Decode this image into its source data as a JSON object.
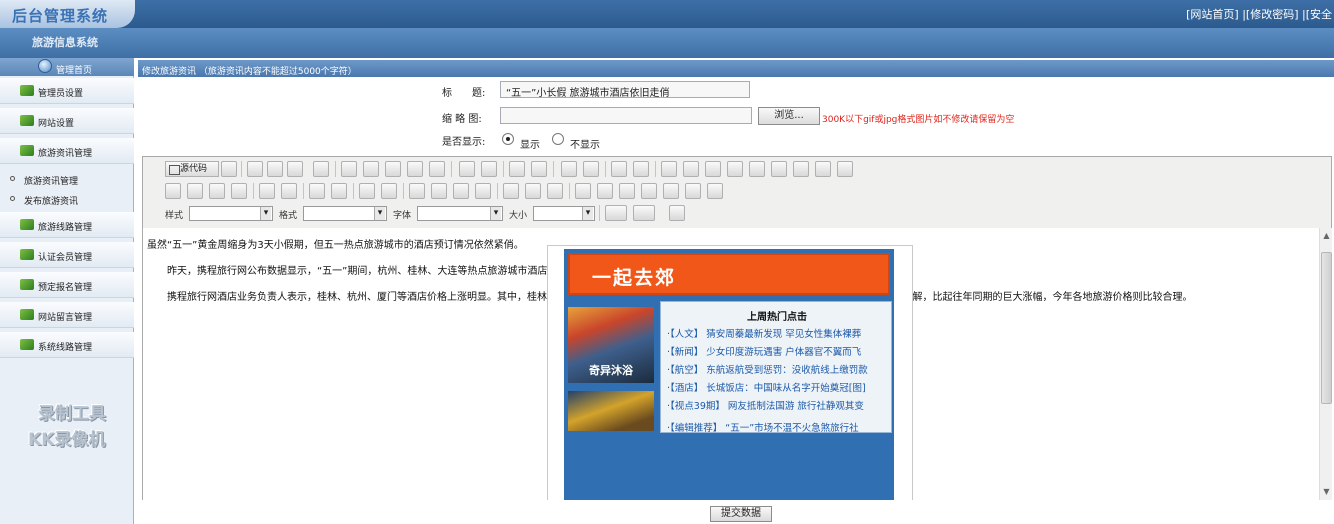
{
  "header": {
    "brand": "后台管理系统",
    "subtitle": "旅游信息系统",
    "links": "[网站首页] |[修改密码] |[安全"
  },
  "sidebar": {
    "home": "管理首页",
    "items": [
      {
        "label": "管理员设置"
      },
      {
        "label": "网站设置"
      },
      {
        "label": "旅游资讯管理"
      }
    ],
    "subitems": [
      {
        "label": "旅游资讯管理"
      },
      {
        "label": "发布旅游资讯"
      }
    ],
    "items2": [
      {
        "label": "旅游线路管理"
      },
      {
        "label": "认证会员管理"
      },
      {
        "label": "预定报名管理"
      },
      {
        "label": "网站留言管理"
      },
      {
        "label": "系统线路管理"
      }
    ],
    "watermark_line1": "录制工具",
    "watermark_line2": "KK录像机"
  },
  "main": {
    "panel_title": "修改旅游资讯 （旅游资讯内容不能超过5000个字符）",
    "title_label": "标　　题:",
    "title_value": "“五一”小长假 旅游城市酒店依旧走俏",
    "thumb_label": "缩 略 图:",
    "thumb_value": "",
    "browse_label": "浏览...",
    "thumb_hint": "300K以下gif或jpg格式图片如不修改请保留为空",
    "show_label": "是否显示:",
    "show_yes": "显示",
    "show_no": "不显示",
    "submit_label": "提交数据"
  },
  "editor": {
    "source_label": "源代码",
    "style_label": "样式",
    "format_label": "格式",
    "font_label": "字体",
    "size_label": "大小",
    "paragraphs": [
      "虽然“五一”黄金周缩身为3天小假期，但五一热点旅游城市的酒店预订情况依然紧俏。",
      "昨天，携程旅行网公布数据显示，“五一”期间，杭州、桂林、大连等热点旅游城市酒店预订紧俏，酒店价格大幅上涨。",
      "携程旅行网酒店业务负责人表示，桂林、杭州、厦门等酒店价格上涨明显。其中，桂林最为突出，其2、3星级酒店价格上升近六成，而4、5星级酒店价格变化不大。据了解，比起往年同期的巨大涨幅，今年各地旅游价格则比较合理。"
    ],
    "embed": {
      "banner": "一起去郊",
      "photo_caption": "奇异沐浴",
      "hot_title": "上周热门点击",
      "hot_items": [
        "·【人文】 猜安周蓁最新发现 罕见女性集体裸葬",
        "·【新闻】 少女印度游玩遇害 户体器官不翼而飞",
        "·【航空】 东航返航受到惩罚：没收航线上缴罚款",
        "·【酒店】 长城饭店：中国味从名字开始奠冠[图]",
        "·【视点39期】 网友抵制法国游 旅行社静观其变",
        "·【编辑推荐】 “五一”市场不温不火急煞旅行社"
      ]
    }
  },
  "colors": {
    "header_blue": "#2c5a8e",
    "hint_red": "#e0231b",
    "banner_orange": "#f05718"
  }
}
